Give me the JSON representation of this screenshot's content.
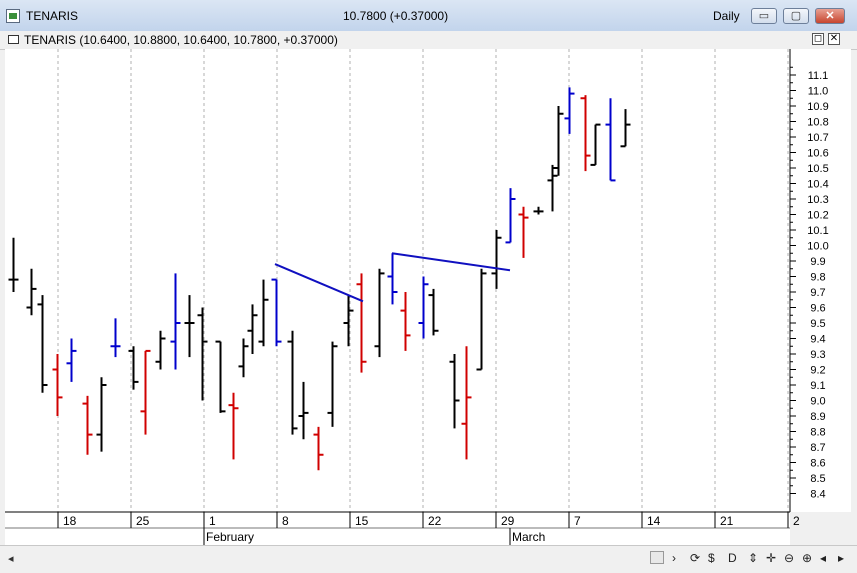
{
  "window": {
    "title": "TENARIS",
    "quote": "10.7800 (+0.37000)",
    "period": "Daily",
    "minimize": "▭",
    "restore": "▢",
    "close": "✕"
  },
  "subwindow": {
    "title": "TENARIS (10.6400, 10.8800, 10.6400, 10.7800, +0.37000)",
    "restore": "◻",
    "close": "✕"
  },
  "toolbar": {
    "scroll_left": "◂",
    "tools": [
      "⟳",
      "$",
      "D",
      "⇕",
      "✛",
      "⊖",
      "⊕",
      "◂",
      "▸"
    ]
  },
  "colors": {
    "up": "#d00000",
    "down": "#0000cc",
    "neutral": "#000000",
    "trendline": "#1010c0",
    "grid": "#b0b0b0"
  },
  "chart_data": {
    "type": "ohlc",
    "ylim": [
      8.2,
      11.45
    ],
    "yticks": [
      "8.4",
      "8.5",
      "8.6",
      "8.7",
      "8.8",
      "8.9",
      "9.0",
      "9.1",
      "9.2",
      "9.3",
      "9.4",
      "9.5",
      "9.6",
      "9.7",
      "9.8",
      "9.9",
      "10.0",
      "10.1",
      "10.2",
      "10.3",
      "10.4",
      "10.5",
      "10.6",
      "10.7",
      "10.8",
      "10.9",
      "11.0",
      "11.1"
    ],
    "xticks": [
      "18",
      "25",
      "1",
      "8",
      "15",
      "22",
      "29",
      "7",
      "14",
      "21",
      "2"
    ],
    "months": [
      "February",
      "March"
    ],
    "bars": [
      {
        "h": 10.05,
        "l": 9.7,
        "o": 9.78,
        "c": 9.78,
        "color": "neutral"
      },
      {
        "h": 9.85,
        "l": 9.55,
        "o": 9.6,
        "c": 9.72,
        "color": "neutral"
      },
      {
        "h": 9.68,
        "l": 9.05,
        "o": 9.62,
        "c": 9.1,
        "color": "neutral"
      },
      {
        "h": 9.3,
        "l": 8.9,
        "o": 9.2,
        "c": 9.02,
        "color": "up"
      },
      {
        "h": 9.4,
        "l": 9.12,
        "o": 9.24,
        "c": 9.32,
        "color": "down"
      },
      {
        "h": 9.03,
        "l": 8.65,
        "o": 8.98,
        "c": 8.78,
        "color": "up"
      },
      {
        "h": 9.15,
        "l": 8.67,
        "o": 8.78,
        "c": 9.1,
        "color": "neutral"
      },
      {
        "h": 9.53,
        "l": 9.28,
        "o": 9.35,
        "c": 9.35,
        "color": "down"
      },
      {
        "h": 9.35,
        "l": 9.07,
        "o": 9.32,
        "c": 9.12,
        "color": "neutral"
      },
      {
        "h": 9.32,
        "l": 8.78,
        "o": 8.93,
        "c": 9.32,
        "color": "up"
      },
      {
        "h": 9.45,
        "l": 9.2,
        "o": 9.25,
        "c": 9.4,
        "color": "neutral"
      },
      {
        "h": 9.82,
        "l": 9.2,
        "o": 9.38,
        "c": 9.5,
        "color": "down"
      },
      {
        "h": 9.68,
        "l": 9.28,
        "o": 9.5,
        "c": 9.5,
        "color": "neutral"
      },
      {
        "h": 9.6,
        "l": 9.0,
        "o": 9.55,
        "c": 9.38,
        "color": "neutral"
      },
      {
        "h": 9.38,
        "l": 8.92,
        "o": 9.38,
        "c": 8.93,
        "color": "neutral"
      },
      {
        "h": 9.05,
        "l": 8.62,
        "o": 8.97,
        "c": 8.95,
        "color": "up"
      },
      {
        "h": 9.4,
        "l": 9.15,
        "o": 9.22,
        "c": 9.35,
        "color": "neutral"
      },
      {
        "h": 9.62,
        "l": 9.3,
        "o": 9.45,
        "c": 9.55,
        "color": "neutral"
      },
      {
        "h": 9.78,
        "l": 9.35,
        "o": 9.38,
        "c": 9.65,
        "color": "neutral"
      },
      {
        "h": 9.78,
        "l": 9.35,
        "o": 9.78,
        "c": 9.38,
        "color": "down"
      },
      {
        "h": 9.45,
        "l": 8.78,
        "o": 9.38,
        "c": 8.82,
        "color": "neutral"
      },
      {
        "h": 9.12,
        "l": 8.75,
        "o": 8.9,
        "c": 8.92,
        "color": "neutral"
      },
      {
        "h": 8.83,
        "l": 8.55,
        "o": 8.78,
        "c": 8.65,
        "color": "up"
      },
      {
        "h": 9.38,
        "l": 8.83,
        "o": 8.92,
        "c": 9.35,
        "color": "neutral"
      },
      {
        "h": 9.68,
        "l": 9.35,
        "o": 9.5,
        "c": 9.58,
        "color": "neutral"
      },
      {
        "h": 9.82,
        "l": 9.18,
        "o": 9.75,
        "c": 9.25,
        "color": "up"
      },
      {
        "h": 9.85,
        "l": 9.28,
        "o": 9.35,
        "c": 9.82,
        "color": "neutral"
      },
      {
        "h": 9.95,
        "l": 9.62,
        "o": 9.8,
        "c": 9.7,
        "color": "down"
      },
      {
        "h": 9.7,
        "l": 9.32,
        "o": 9.58,
        "c": 9.42,
        "color": "up"
      },
      {
        "h": 9.8,
        "l": 9.4,
        "o": 9.5,
        "c": 9.75,
        "color": "down"
      },
      {
        "h": 9.72,
        "l": 9.42,
        "o": 9.68,
        "c": 9.45,
        "color": "neutral"
      },
      {
        "h": 9.3,
        "l": 8.82,
        "o": 9.25,
        "c": 9.0,
        "color": "neutral"
      },
      {
        "h": 9.35,
        "l": 8.62,
        "o": 8.85,
        "c": 9.02,
        "color": "up"
      },
      {
        "h": 9.85,
        "l": 9.2,
        "o": 9.2,
        "c": 9.82,
        "color": "neutral"
      },
      {
        "h": 10.1,
        "l": 9.72,
        "o": 9.82,
        "c": 10.05,
        "color": "neutral"
      },
      {
        "h": 10.37,
        "l": 10.02,
        "o": 10.02,
        "c": 10.3,
        "color": "down"
      },
      {
        "h": 10.25,
        "l": 9.92,
        "o": 10.2,
        "c": 10.18,
        "color": "up"
      },
      {
        "h": 10.25,
        "l": 10.2,
        "o": 10.22,
        "c": 10.22,
        "color": "neutral"
      },
      {
        "h": 10.52,
        "l": 10.22,
        "o": 10.42,
        "c": 10.45,
        "color": "neutral"
      },
      {
        "h": 10.9,
        "l": 10.45,
        "o": 10.5,
        "c": 10.85,
        "color": "neutral"
      },
      {
        "h": 11.02,
        "l": 10.72,
        "o": 10.82,
        "c": 10.98,
        "color": "down"
      },
      {
        "h": 10.97,
        "l": 10.48,
        "o": 10.95,
        "c": 10.58,
        "color": "up"
      },
      {
        "h": 10.78,
        "l": 10.52,
        "o": 10.52,
        "c": 10.78,
        "color": "neutral"
      },
      {
        "h": 10.95,
        "l": 10.42,
        "o": 10.78,
        "c": 10.42,
        "color": "down"
      },
      {
        "h": 10.88,
        "l": 10.64,
        "o": 10.64,
        "c": 10.78,
        "color": "neutral"
      }
    ],
    "trendlines": [
      {
        "points": [
          [
            18,
            9.88
          ],
          [
            23.6,
            9.64
          ]
        ]
      },
      {
        "points": [
          [
            25.5,
            9.95
          ],
          [
            32.6,
            9.84
          ]
        ]
      }
    ]
  }
}
